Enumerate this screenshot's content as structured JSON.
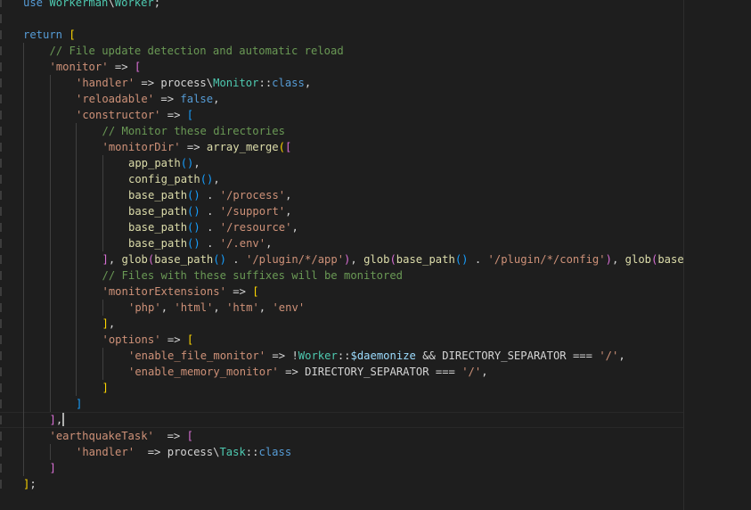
{
  "editor": {
    "language": "php",
    "colors": {
      "background": "#1e1e1e",
      "keyword": "#569cd6",
      "namespace": "#4ec9b0",
      "string": "#ce9178",
      "comment": "#6a9955",
      "function": "#dcdcaa",
      "variable": "#9cdcfe",
      "bracket_level_1": "#ffd700",
      "bracket_level_2": "#da70d6",
      "bracket_level_3": "#179fff"
    },
    "current_line": 26,
    "lines": [
      {
        "indent": 0,
        "tokens": [
          [
            "kw",
            "use "
          ],
          [
            "ns",
            "Workerman"
          ],
          [
            "op",
            "\\"
          ],
          [
            "ns",
            "Worker"
          ],
          [
            "op",
            ";"
          ]
        ]
      },
      {
        "indent": 0,
        "tokens": []
      },
      {
        "indent": 0,
        "tokens": [
          [
            "kw",
            "return "
          ],
          [
            "b1",
            "["
          ]
        ]
      },
      {
        "indent": 1,
        "tokens": [
          [
            "com",
            "// File update detection and automatic reload"
          ]
        ]
      },
      {
        "indent": 1,
        "tokens": [
          [
            "str",
            "'monitor'"
          ],
          [
            "op",
            " => "
          ],
          [
            "b2",
            "["
          ]
        ]
      },
      {
        "indent": 2,
        "tokens": [
          [
            "str",
            "'handler'"
          ],
          [
            "op",
            " => process\\"
          ],
          [
            "ns",
            "Monitor"
          ],
          [
            "op",
            "::"
          ],
          [
            "kw",
            "class"
          ],
          [
            "op",
            ","
          ]
        ]
      },
      {
        "indent": 2,
        "tokens": [
          [
            "str",
            "'reloadable'"
          ],
          [
            "op",
            " => "
          ],
          [
            "kw",
            "false"
          ],
          [
            "op",
            ","
          ]
        ]
      },
      {
        "indent": 2,
        "tokens": [
          [
            "str",
            "'constructor'"
          ],
          [
            "op",
            " => "
          ],
          [
            "b3",
            "["
          ]
        ]
      },
      {
        "indent": 3,
        "tokens": [
          [
            "com",
            "// Monitor these directories"
          ]
        ]
      },
      {
        "indent": 3,
        "tokens": [
          [
            "str",
            "'monitorDir'"
          ],
          [
            "op",
            " => "
          ],
          [
            "fn",
            "array_merge"
          ],
          [
            "b1",
            "("
          ],
          [
            "b2",
            "["
          ]
        ]
      },
      {
        "indent": 4,
        "tokens": [
          [
            "fn",
            "app_path"
          ],
          [
            "b3",
            "()"
          ],
          [
            "op",
            ","
          ]
        ]
      },
      {
        "indent": 4,
        "tokens": [
          [
            "fn",
            "config_path"
          ],
          [
            "b3",
            "()"
          ],
          [
            "op",
            ","
          ]
        ]
      },
      {
        "indent": 4,
        "tokens": [
          [
            "fn",
            "base_path"
          ],
          [
            "b3",
            "()"
          ],
          [
            "op",
            " . "
          ],
          [
            "str",
            "'/process'"
          ],
          [
            "op",
            ","
          ]
        ]
      },
      {
        "indent": 4,
        "tokens": [
          [
            "fn",
            "base_path"
          ],
          [
            "b3",
            "()"
          ],
          [
            "op",
            " . "
          ],
          [
            "str",
            "'/support'"
          ],
          [
            "op",
            ","
          ]
        ]
      },
      {
        "indent": 4,
        "tokens": [
          [
            "fn",
            "base_path"
          ],
          [
            "b3",
            "()"
          ],
          [
            "op",
            " . "
          ],
          [
            "str",
            "'/resource'"
          ],
          [
            "op",
            ","
          ]
        ]
      },
      {
        "indent": 4,
        "tokens": [
          [
            "fn",
            "base_path"
          ],
          [
            "b3",
            "()"
          ],
          [
            "op",
            " . "
          ],
          [
            "str",
            "'/.env'"
          ],
          [
            "op",
            ","
          ]
        ]
      },
      {
        "indent": 3,
        "tokens": [
          [
            "b2",
            "]"
          ],
          [
            "op",
            ", "
          ],
          [
            "fn",
            "glob"
          ],
          [
            "b2",
            "("
          ],
          [
            "fn",
            "base_path"
          ],
          [
            "b3",
            "()"
          ],
          [
            "op",
            " . "
          ],
          [
            "str",
            "'/plugin/*/app'"
          ],
          [
            "b2",
            ")"
          ],
          [
            "op",
            ", "
          ],
          [
            "fn",
            "glob"
          ],
          [
            "b2",
            "("
          ],
          [
            "fn",
            "base_path"
          ],
          [
            "b3",
            "()"
          ],
          [
            "op",
            " . "
          ],
          [
            "str",
            "'/plugin/*/config'"
          ],
          [
            "b2",
            ")"
          ],
          [
            "op",
            ", "
          ],
          [
            "fn",
            "glob"
          ],
          [
            "b2",
            "("
          ],
          [
            "fn",
            "base_"
          ]
        ]
      },
      {
        "indent": 3,
        "tokens": [
          [
            "com",
            "// Files with these suffixes will be monitored"
          ]
        ]
      },
      {
        "indent": 3,
        "tokens": [
          [
            "str",
            "'monitorExtensions'"
          ],
          [
            "op",
            " => "
          ],
          [
            "b1",
            "["
          ]
        ]
      },
      {
        "indent": 4,
        "tokens": [
          [
            "str",
            "'php'"
          ],
          [
            "op",
            ", "
          ],
          [
            "str",
            "'html'"
          ],
          [
            "op",
            ", "
          ],
          [
            "str",
            "'htm'"
          ],
          [
            "op",
            ", "
          ],
          [
            "str",
            "'env'"
          ]
        ]
      },
      {
        "indent": 3,
        "tokens": [
          [
            "b1",
            "]"
          ],
          [
            "op",
            ","
          ]
        ]
      },
      {
        "indent": 3,
        "tokens": [
          [
            "str",
            "'options'"
          ],
          [
            "op",
            " => "
          ],
          [
            "b1",
            "["
          ]
        ]
      },
      {
        "indent": 4,
        "tokens": [
          [
            "str",
            "'enable_file_monitor'"
          ],
          [
            "op",
            " => !"
          ],
          [
            "ns",
            "Worker"
          ],
          [
            "op",
            "::"
          ],
          [
            "var",
            "$daemonize"
          ],
          [
            "op",
            " && DIRECTORY_SEPARATOR === "
          ],
          [
            "str",
            "'/'"
          ],
          [
            "op",
            ","
          ]
        ]
      },
      {
        "indent": 4,
        "tokens": [
          [
            "str",
            "'enable_memory_monitor'"
          ],
          [
            "op",
            " => DIRECTORY_SEPARATOR === "
          ],
          [
            "str",
            "'/'"
          ],
          [
            "op",
            ","
          ]
        ]
      },
      {
        "indent": 3,
        "tokens": [
          [
            "b1",
            "]"
          ]
        ]
      },
      {
        "indent": 2,
        "tokens": [
          [
            "b3",
            "]"
          ]
        ]
      },
      {
        "indent": 1,
        "tokens": [
          [
            "b2",
            "]"
          ],
          [
            "op",
            ","
          ]
        ]
      },
      {
        "indent": 1,
        "tokens": [
          [
            "str",
            "'earthquakeTask'"
          ],
          [
            "op",
            "  => "
          ],
          [
            "b2",
            "["
          ]
        ]
      },
      {
        "indent": 2,
        "tokens": [
          [
            "str",
            "'handler'"
          ],
          [
            "op",
            "  => process\\"
          ],
          [
            "ns",
            "Task"
          ],
          [
            "op",
            "::"
          ],
          [
            "kw",
            "class"
          ]
        ]
      },
      {
        "indent": 1,
        "tokens": [
          [
            "b2",
            "]"
          ]
        ]
      },
      {
        "indent": 0,
        "tokens": [
          [
            "b1",
            "]"
          ],
          [
            "op",
            ";"
          ]
        ]
      }
    ]
  }
}
